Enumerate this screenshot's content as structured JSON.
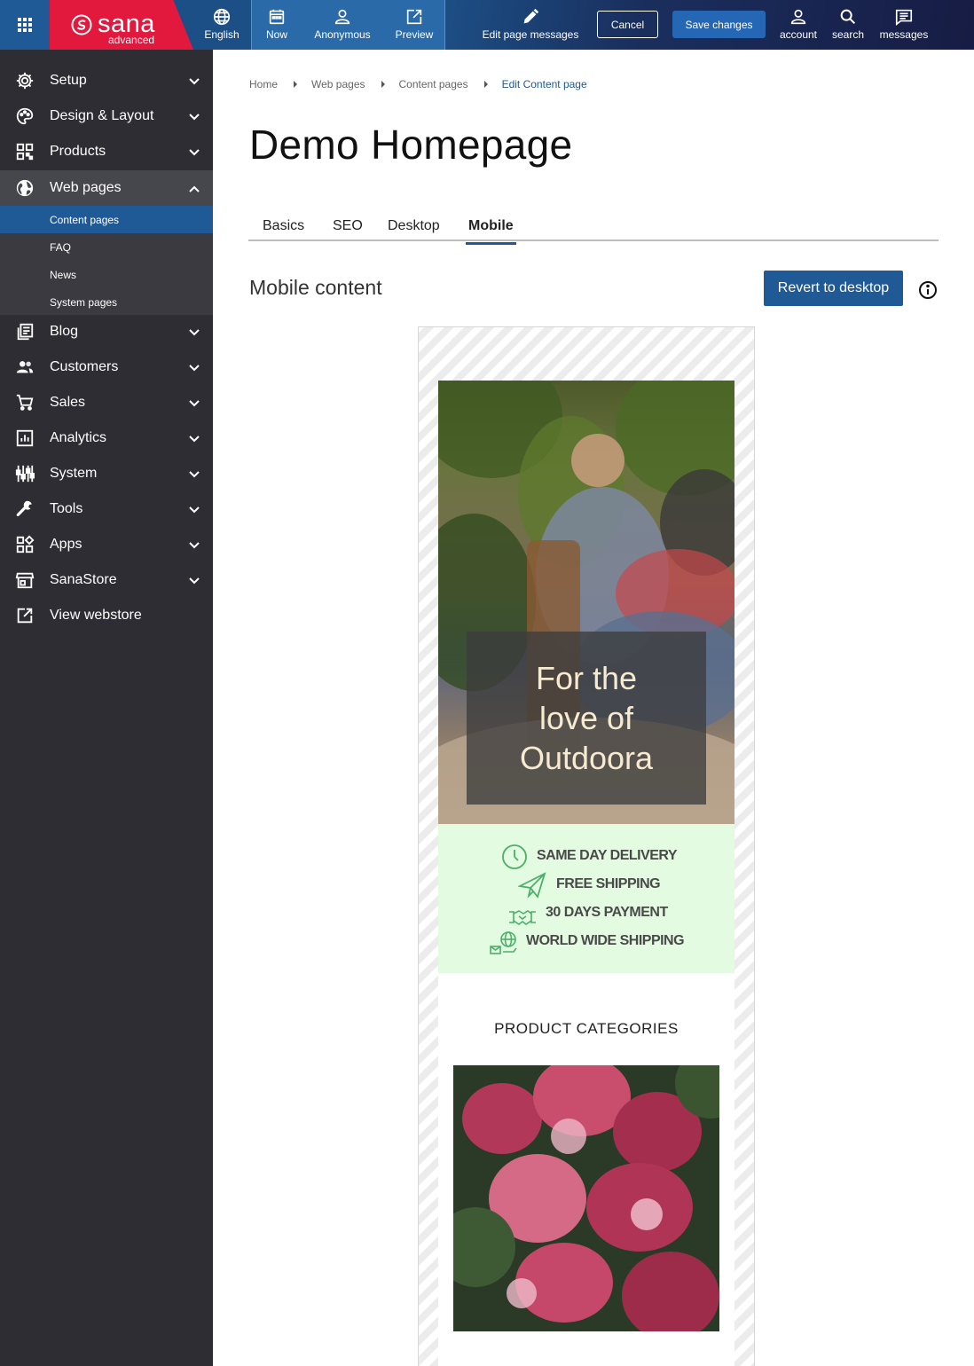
{
  "topbar": {
    "logo_text": "sana",
    "logo_sub": "advanced",
    "language": "English",
    "date": "Now",
    "visitor": "Anonymous",
    "preview": "Preview",
    "edit_messages": "Edit page messages",
    "cancel": "Cancel",
    "save": "Save changes",
    "account": "account",
    "search": "search",
    "messages": "messages"
  },
  "sidebar": {
    "items": [
      {
        "label": "Setup",
        "icon": "gear-icon"
      },
      {
        "label": "Design & Layout",
        "icon": "palette-icon"
      },
      {
        "label": "Products",
        "icon": "qr-icon"
      },
      {
        "label": "Web pages",
        "icon": "globe-icon"
      },
      {
        "label": "Blog",
        "icon": "blog-icon"
      },
      {
        "label": "Customers",
        "icon": "people-icon"
      },
      {
        "label": "Sales",
        "icon": "cart-icon"
      },
      {
        "label": "Analytics",
        "icon": "chart-icon"
      },
      {
        "label": "System",
        "icon": "sliders-icon"
      },
      {
        "label": "Tools",
        "icon": "wrench-icon"
      },
      {
        "label": "Apps",
        "icon": "apps-icon"
      },
      {
        "label": "SanaStore",
        "icon": "store-icon"
      },
      {
        "label": "View webstore",
        "icon": "external-link-icon"
      }
    ],
    "subitems": [
      "Content pages",
      "FAQ",
      "News",
      "System pages"
    ]
  },
  "breadcrumb": [
    "Home",
    "Web pages",
    "Content pages",
    "Edit Content page"
  ],
  "page_title": "Demo Homepage",
  "tabs": [
    "Basics",
    "SEO",
    "Desktop",
    "Mobile"
  ],
  "section_title": "Mobile content",
  "revert_button": "Revert to desktop",
  "preview": {
    "hero_lines": [
      "For the",
      "love of",
      "Outdoora"
    ],
    "benefits": [
      "SAME DAY DELIVERY",
      "FREE SHIPPING",
      "30 DAYS PAYMENT",
      "WORLD WIDE SHIPPING"
    ],
    "product_categories_title": "PRODUCT CATEGORIES"
  },
  "colors": {
    "brand_red": "#e3183d",
    "primary_blue": "#1f5a96",
    "sidebar_bg": "#2d2d33",
    "benefit_bg": "#e3fbe0",
    "benefit_icon": "#4caf6a"
  }
}
